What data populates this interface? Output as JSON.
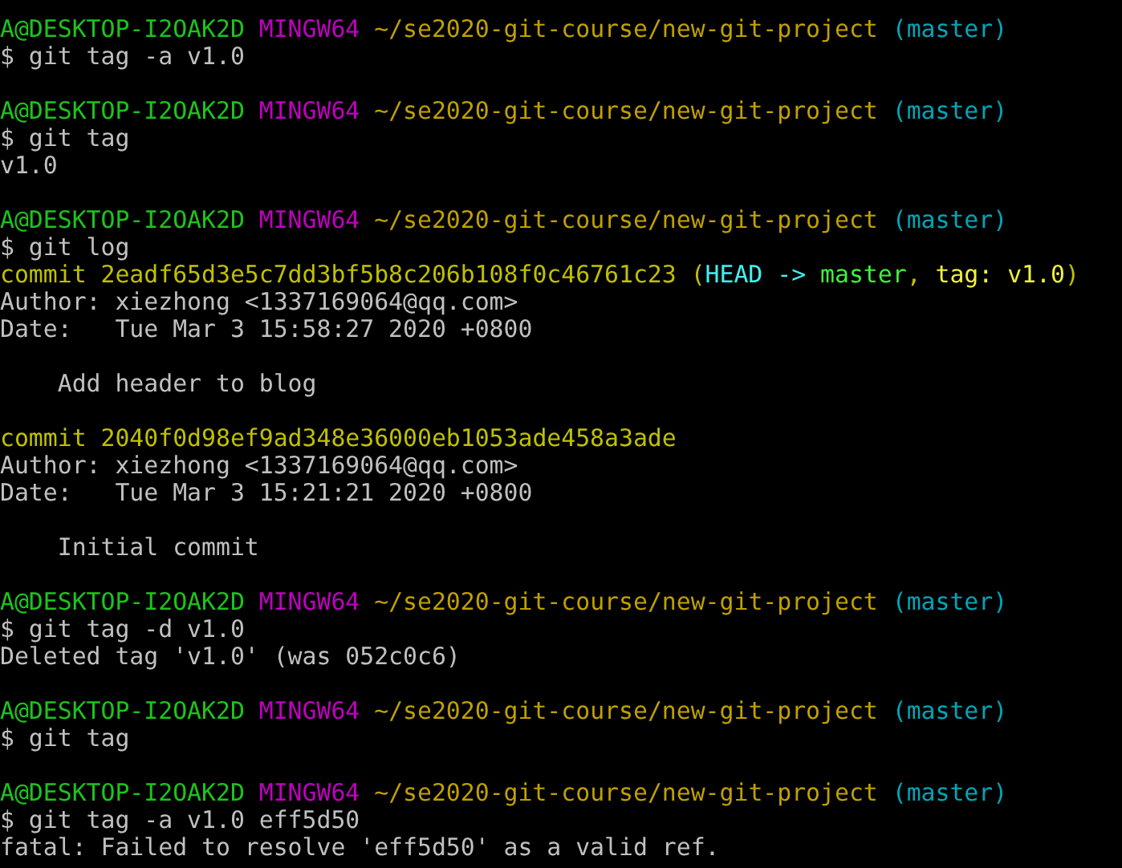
{
  "lines": [
    {
      "kind": "text",
      "segments": [
        {
          "kind": "user_host",
          "text": "A@DESKTOP-I2OAK2D"
        },
        {
          "kind": "system",
          "text": " MINGW64"
        },
        {
          "kind": "path",
          "text": " ~/se2020-git-course/new-git-project"
        },
        {
          "kind": "branch",
          "text": " (master)"
        }
      ]
    },
    {
      "kind": "text",
      "segments": [
        {
          "kind": "plain",
          "text": "$ git tag -a v1.0"
        }
      ]
    },
    {
      "kind": "blank"
    },
    {
      "kind": "text",
      "segments": [
        {
          "kind": "user_host",
          "text": "A@DESKTOP-I2OAK2D"
        },
        {
          "kind": "system",
          "text": " MINGW64"
        },
        {
          "kind": "path",
          "text": " ~/se2020-git-course/new-git-project"
        },
        {
          "kind": "branch",
          "text": " (master)"
        }
      ]
    },
    {
      "kind": "text",
      "segments": [
        {
          "kind": "plain",
          "text": "$ git tag"
        }
      ]
    },
    {
      "kind": "text",
      "segments": [
        {
          "kind": "plain",
          "text": "v1.0"
        }
      ]
    },
    {
      "kind": "blank"
    },
    {
      "kind": "text",
      "segments": [
        {
          "kind": "user_host",
          "text": "A@DESKTOP-I2OAK2D"
        },
        {
          "kind": "system",
          "text": " MINGW64"
        },
        {
          "kind": "path",
          "text": " ~/se2020-git-course/new-git-project"
        },
        {
          "kind": "branch",
          "text": " (master)"
        }
      ]
    },
    {
      "kind": "text",
      "segments": [
        {
          "kind": "plain",
          "text": "$ git log"
        }
      ]
    },
    {
      "kind": "text",
      "segments": [
        {
          "kind": "commit",
          "text": "commit 2eadf65d3e5c7dd3bf5b8c206b108f0c46761c23 ("
        },
        {
          "kind": "head",
          "text": "HEAD -> "
        },
        {
          "kind": "ref_branch",
          "text": "master"
        },
        {
          "kind": "commit",
          "text": ", "
        },
        {
          "kind": "ref_tag",
          "text": "tag: v1.0"
        },
        {
          "kind": "commit",
          "text": ")"
        }
      ]
    },
    {
      "kind": "text",
      "segments": [
        {
          "kind": "plain",
          "text": "Author: xiezhong <1337169064@qq.com>"
        }
      ]
    },
    {
      "kind": "text",
      "segments": [
        {
          "kind": "plain",
          "text": "Date:   Tue Mar 3 15:58:27 2020 +0800"
        }
      ]
    },
    {
      "kind": "blank"
    },
    {
      "kind": "text",
      "segments": [
        {
          "kind": "plain",
          "text": "    Add header to blog"
        }
      ]
    },
    {
      "kind": "blank"
    },
    {
      "kind": "text",
      "segments": [
        {
          "kind": "commit",
          "text": "commit 2040f0d98ef9ad348e36000eb1053ade458a3ade"
        }
      ]
    },
    {
      "kind": "text",
      "segments": [
        {
          "kind": "plain",
          "text": "Author: xiezhong <1337169064@qq.com>"
        }
      ]
    },
    {
      "kind": "text",
      "segments": [
        {
          "kind": "plain",
          "text": "Date:   Tue Mar 3 15:21:21 2020 +0800"
        }
      ]
    },
    {
      "kind": "blank"
    },
    {
      "kind": "text",
      "segments": [
        {
          "kind": "plain",
          "text": "    Initial commit"
        }
      ]
    },
    {
      "kind": "blank"
    },
    {
      "kind": "text",
      "segments": [
        {
          "kind": "user_host",
          "text": "A@DESKTOP-I2OAK2D"
        },
        {
          "kind": "system",
          "text": " MINGW64"
        },
        {
          "kind": "path",
          "text": " ~/se2020-git-course/new-git-project"
        },
        {
          "kind": "branch",
          "text": " (master)"
        }
      ]
    },
    {
      "kind": "text",
      "segments": [
        {
          "kind": "plain",
          "text": "$ git tag -d v1.0"
        }
      ]
    },
    {
      "kind": "text",
      "segments": [
        {
          "kind": "plain",
          "text": "Deleted tag 'v1.0' (was 052c0c6)"
        }
      ]
    },
    {
      "kind": "blank"
    },
    {
      "kind": "text",
      "segments": [
        {
          "kind": "user_host",
          "text": "A@DESKTOP-I2OAK2D"
        },
        {
          "kind": "system",
          "text": " MINGW64"
        },
        {
          "kind": "path",
          "text": " ~/se2020-git-course/new-git-project"
        },
        {
          "kind": "branch",
          "text": " (master)"
        }
      ]
    },
    {
      "kind": "text",
      "segments": [
        {
          "kind": "plain",
          "text": "$ git tag"
        }
      ]
    },
    {
      "kind": "blank"
    },
    {
      "kind": "text",
      "segments": [
        {
          "kind": "user_host",
          "text": "A@DESKTOP-I2OAK2D"
        },
        {
          "kind": "system",
          "text": " MINGW64"
        },
        {
          "kind": "path",
          "text": " ~/se2020-git-course/new-git-project"
        },
        {
          "kind": "branch",
          "text": " (master)"
        }
      ]
    },
    {
      "kind": "text",
      "segments": [
        {
          "kind": "plain",
          "text": "$ git tag -a v1.0 eff5d50"
        }
      ]
    },
    {
      "kind": "text",
      "segments": [
        {
          "kind": "plain",
          "text": "fatal: Failed to resolve 'eff5d50' as a valid ref."
        }
      ]
    }
  ]
}
